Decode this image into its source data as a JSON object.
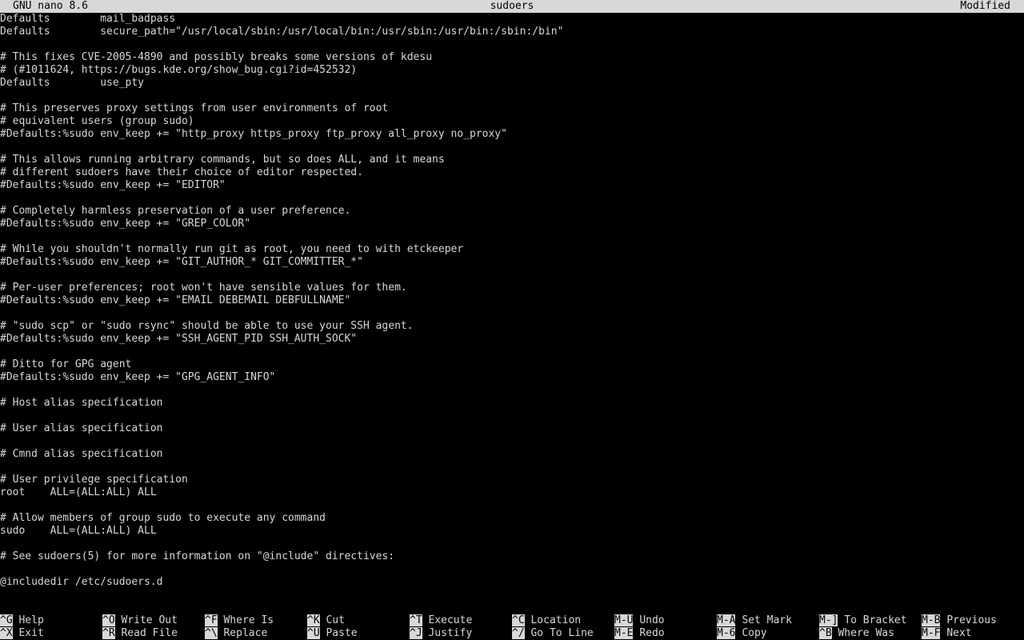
{
  "titlebar": {
    "app": "GNU nano 8.6",
    "filename": "sudoers",
    "status": "Modified"
  },
  "editor": {
    "lines": [
      "Defaults        mail_badpass",
      "Defaults        secure_path=\"/usr/local/sbin:/usr/local/bin:/usr/sbin:/usr/bin:/sbin:/bin\"",
      "",
      "# This fixes CVE-2005-4890 and possibly breaks some versions of kdesu",
      "# (#1011624, https://bugs.kde.org/show_bug.cgi?id=452532)",
      "Defaults        use_pty",
      "",
      "# This preserves proxy settings from user environments of root",
      "# equivalent users (group sudo)",
      "#Defaults:%sudo env_keep += \"http_proxy https_proxy ftp_proxy all_proxy no_proxy\"",
      "",
      "# This allows running arbitrary commands, but so does ALL, and it means",
      "# different sudoers have their choice of editor respected.",
      "#Defaults:%sudo env_keep += \"EDITOR\"",
      "",
      "# Completely harmless preservation of a user preference.",
      "#Defaults:%sudo env_keep += \"GREP_COLOR\"",
      "",
      "# While you shouldn't normally run git as root, you need to with etckeeper",
      "#Defaults:%sudo env_keep += \"GIT_AUTHOR_* GIT_COMMITTER_*\"",
      "",
      "# Per-user preferences; root won't have sensible values for them.",
      "#Defaults:%sudo env_keep += \"EMAIL DEBEMAIL DEBFULLNAME\"",
      "",
      "# \"sudo scp\" or \"sudo rsync\" should be able to use your SSH agent.",
      "#Defaults:%sudo env_keep += \"SSH_AGENT_PID SSH_AUTH_SOCK\"",
      "",
      "# Ditto for GPG agent",
      "#Defaults:%sudo env_keep += \"GPG_AGENT_INFO\"",
      "",
      "# Host alias specification",
      "",
      "# User alias specification",
      "",
      "# Cmnd alias specification",
      "",
      "# User privilege specification",
      "root    ALL=(ALL:ALL) ALL",
      "",
      "# Allow members of group sudo to execute any command",
      "sudo    ALL=(ALL:ALL) ALL",
      "",
      "# See sudoers(5) for more information on \"@include\" directives:",
      "",
      "@includedir /etc/sudoers.d",
      ""
    ]
  },
  "shortcuts": {
    "row1": [
      {
        "key": "^G",
        "label": "Help"
      },
      {
        "key": "^O",
        "label": "Write Out"
      },
      {
        "key": "^F",
        "label": "Where Is"
      },
      {
        "key": "^K",
        "label": "Cut"
      },
      {
        "key": "^T",
        "label": "Execute"
      },
      {
        "key": "^C",
        "label": "Location"
      },
      {
        "key": "M-U",
        "label": "Undo"
      },
      {
        "key": "M-A",
        "label": "Set Mark"
      },
      {
        "key": "M-]",
        "label": "To Bracket"
      },
      {
        "key": "M-B",
        "label": "Previous"
      }
    ],
    "row2": [
      {
        "key": "^X",
        "label": "Exit"
      },
      {
        "key": "^R",
        "label": "Read File"
      },
      {
        "key": "^\\",
        "label": "Replace"
      },
      {
        "key": "^U",
        "label": "Paste"
      },
      {
        "key": "^J",
        "label": "Justify"
      },
      {
        "key": "^/",
        "label": "Go To Line"
      },
      {
        "key": "M-E",
        "label": "Redo"
      },
      {
        "key": "M-6",
        "label": "Copy"
      },
      {
        "key": "^B",
        "label": "Where Was"
      },
      {
        "key": "M-F",
        "label": "Next"
      }
    ]
  },
  "colors": {
    "background": "#000000",
    "foreground": "#d8d8d8",
    "inverse_bg": "#d8d8d8",
    "inverse_fg": "#000000"
  }
}
